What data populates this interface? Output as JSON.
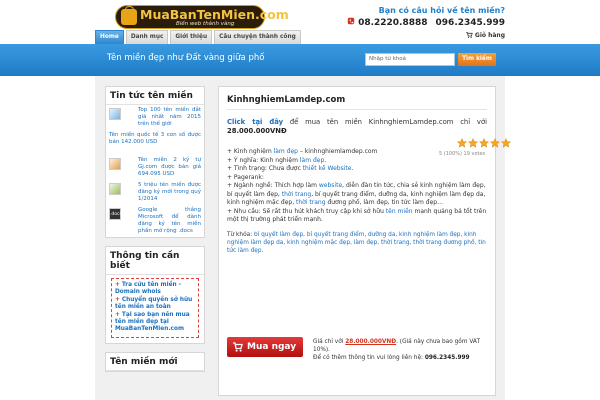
{
  "header": {
    "logo_text": "MuaBanTenMien.com",
    "logo_sub": "Biến web thành vàng",
    "question": "Bạn có câu hỏi về tên miền?",
    "phone1": "08.2220.8888",
    "phone2": "096.2345.999"
  },
  "nav": {
    "tabs": [
      "Home",
      "Danh mục",
      "Giới thiệu",
      "Câu chuyện thành công"
    ],
    "cart_label": "Giỏ hàng"
  },
  "banner": {
    "slogan": "Tên miền đẹp như Đất vàng giữa phố",
    "search_placeholder": "Nhập từ khoá",
    "search_button": "Tìm kiếm"
  },
  "sidebar": {
    "news_title": "Tin tức tên miền",
    "news": [
      {
        "text": "Top 100 tên miền đắt giá nhất năm 2015 trên thế giới",
        "thumb": ""
      },
      {
        "text": "Tên miền quốc tế 3 con số được bán 142.000 USD",
        "thumb": ""
      },
      {
        "text": "Tên miền 2 ký tự Gj.com được bán giá 694.095 USD",
        "thumb": ""
      },
      {
        "text": "5 triệu tên miền được đăng ký mới trong quý 1/2014",
        "thumb": ""
      },
      {
        "text": "Google thắng Microsoft để dành đăng ký tên miền phần mở rộng .docs",
        "thumb": ".docs"
      }
    ],
    "info_title": "Thông tin cần biết",
    "info_links": [
      "Tra cứu tên miền - Domain whois",
      "Chuyển quyền sở hữu tên miền an toàn",
      "Tại sao bạn nên mua tên miền đẹp tại MuaBanTenMien.com"
    ],
    "new_title": "Tên miền mới"
  },
  "main": {
    "title": "KinhnghiemLamdep.com",
    "click_label": "Click tại đây",
    "offer_text": " để mua tên miền KinhnghiemLamdep.com chỉ với ",
    "offer_price": "28.000.000VNĐ",
    "desc_line1_a": "+ Kinh nghiệm ",
    "desc_line1_link": "làm đẹp",
    "desc_line1_b": " – kinhnghiemlamdep.com",
    "desc_line2_a": "+ Ý nghĩa: Kinh nghiệm ",
    "desc_line2_link": "làm đẹp",
    "desc_line2_b": ".",
    "desc_line3_a": "+ Tình trạng: Chưa được ",
    "desc_line3_link": "thiết kế Website",
    "desc_line3_b": ".",
    "desc_line4": "+ Pagerank:",
    "desc_line5_a": "+ Ngành nghề: Thích hợp làm ",
    "desc_line5_link": "website",
    "desc_line5_b": ", diễn đàn tin tức, chia sẻ kinh nghiệm làm đẹp, bí quyết làm đẹp, ",
    "desc_line5_link2": "thời trang",
    "desc_line5_c": ", bí quyết trang điểm, dưỡng da, kinh nghiệm làm đẹp da, kinh nghiệm mặc đẹp, ",
    "desc_line5_link3": "thời trang",
    "desc_line5_d": " đương phố, làm đẹp, tin tức làm đẹp…",
    "desc_line6_a": "+ Nhu cầu: Sẽ rất thu hút khách truy cập khi sở hữu ",
    "desc_line6_link": "tên miền",
    "desc_line6_b": " mạnh quảng bá tốt trên một thị trường phát triển mạnh.",
    "stars": 5,
    "rating_text": "5 (100%) 19 votes",
    "tags_label": "Từ khóa: ",
    "tags": "bí quyết làm đẹp, bí quyết trang điểm, dưỡng da, kinh nghiệm làm đẹp, kinh nghiệm làm đẹp da, kinh nghiệm mặc đẹp, làm đẹp, thời trang, thời trang đương phố, tin tức làm đẹp.",
    "buy_label": "Mua ngay",
    "buy_line1_a": "Giá chỉ với ",
    "buy_line1_price": "28.000.000VNĐ",
    "buy_line1_b": ". (Giá này chưa bao gồm VAT 10%).",
    "buy_line2_a": "Để có thêm thông tin vui lòng liên hệ: ",
    "buy_line2_phone": "096.2345.999"
  },
  "colors": {
    "banner": "#1f7bc6",
    "accent_orange": "#e3731a",
    "buy_red": "#c41c1c",
    "link": "#1a6fbf",
    "star": "#f5a623"
  }
}
